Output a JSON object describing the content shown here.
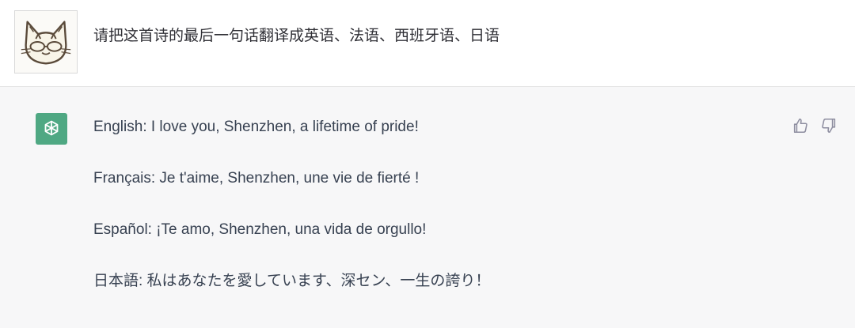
{
  "user_message": {
    "avatar": "cat-avatar-icon",
    "text": "请把这首诗的最后一句话翻译成英语、法语、西班牙语、日语"
  },
  "assistant_message": {
    "avatar": "openai-logo-icon",
    "lines": [
      "English: I love you, Shenzhen, a lifetime of pride!",
      "Français: Je t'aime, Shenzhen, une vie de fierté !",
      "Español: ¡Te amo, Shenzhen, una vida de orgullo!",
      "日本語: 私はあなたを愛しています、深セン、一生の誇り！"
    ],
    "feedback_icons": [
      "thumbs-up-icon",
      "thumbs-down-icon"
    ]
  },
  "colors": {
    "assistant_bg": "#f7f7f8",
    "bot_avatar_bg": "#4fa883",
    "text": "#374151",
    "icon": "#8e8ea0"
  }
}
